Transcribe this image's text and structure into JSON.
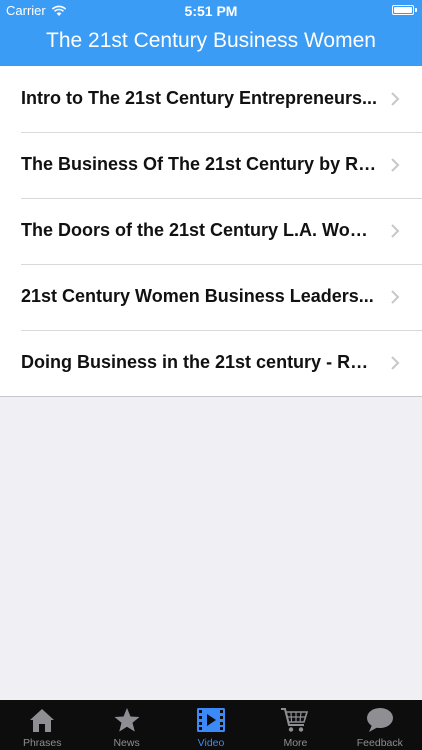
{
  "status_bar": {
    "carrier": "Carrier",
    "time": "5:51 PM"
  },
  "header": {
    "title": "The 21st Century Business Women"
  },
  "list": {
    "items": [
      {
        "label": "Intro to The 21st Century Entrepreneurs..."
      },
      {
        "label": "The Business Of The 21st Century by Ro..."
      },
      {
        "label": "The Doors of the 21st Century L.A. Wom..."
      },
      {
        "label": "21st Century Women Business Leaders..."
      },
      {
        "label": "Doing Business in the 21st century - Rob..."
      }
    ]
  },
  "tabbar": {
    "tabs": [
      {
        "label": "Phrases",
        "icon": "house-icon",
        "active": false
      },
      {
        "label": "News",
        "icon": "star-icon",
        "active": false
      },
      {
        "label": "Video",
        "icon": "video-icon",
        "active": true
      },
      {
        "label": "More",
        "icon": "cart-icon",
        "active": false
      },
      {
        "label": "Feedback",
        "icon": "speech-bubble-icon",
        "active": false
      }
    ]
  },
  "colors": {
    "header": "#3b9cf5",
    "background": "#efeff4",
    "tabbar": "#0d0d0d",
    "tab_active": "#3b8af7",
    "tab_inactive": "#8e8e93"
  }
}
